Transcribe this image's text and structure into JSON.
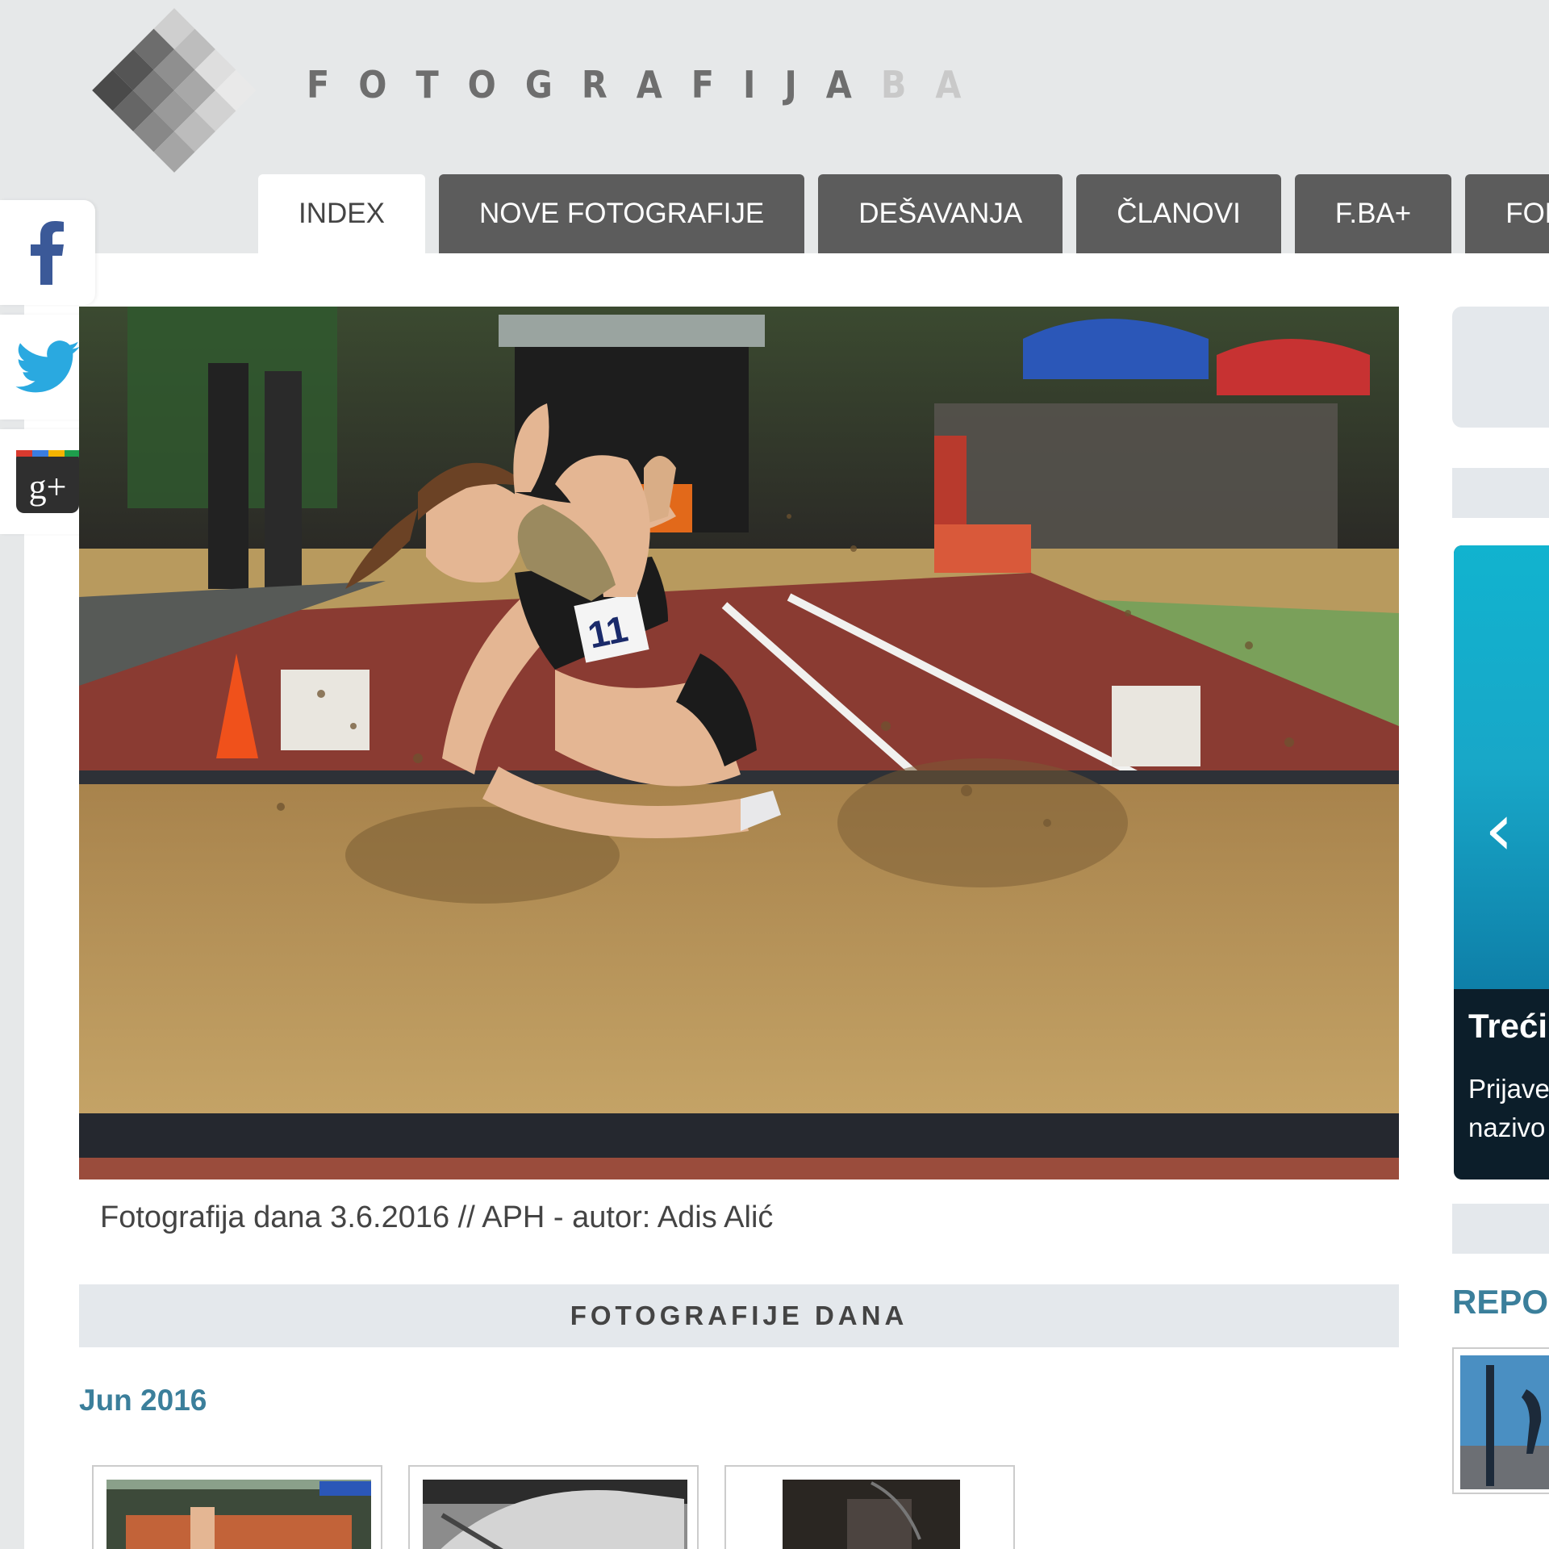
{
  "site": {
    "name": "FOTOGRAFIJA",
    "tld": "BA",
    "colors": {
      "nav_bg": "#5c5c5c",
      "accent": "#3b7f9b",
      "page_bg": "#e6e8e9"
    }
  },
  "nav": {
    "tabs": [
      {
        "label": "INDEX",
        "active": true
      },
      {
        "label": "NOVE FOTOGRAFIJE",
        "active": false
      },
      {
        "label": "DEŠAVANJA",
        "active": false
      },
      {
        "label": "ČLANOVI",
        "active": false
      },
      {
        "label": "F.BA+",
        "active": false
      },
      {
        "label": "FORU",
        "active": false
      }
    ]
  },
  "social": {
    "icons": [
      "facebook-icon",
      "twitter-icon",
      "google-plus-icon"
    ]
  },
  "hero": {
    "caption": "Fotografija dana 3.6.2016 // APH - autor: Adis Alić",
    "bib_number": "11"
  },
  "section": {
    "title": "FOTOGRAFIJE DANA",
    "month": "Jun 2016"
  },
  "sidebar": {
    "slider_title": "Treći",
    "slider_text_1": "Prijave",
    "slider_text_2": "nazivo",
    "slider_arrow": "‹",
    "report_title": "REPO"
  }
}
